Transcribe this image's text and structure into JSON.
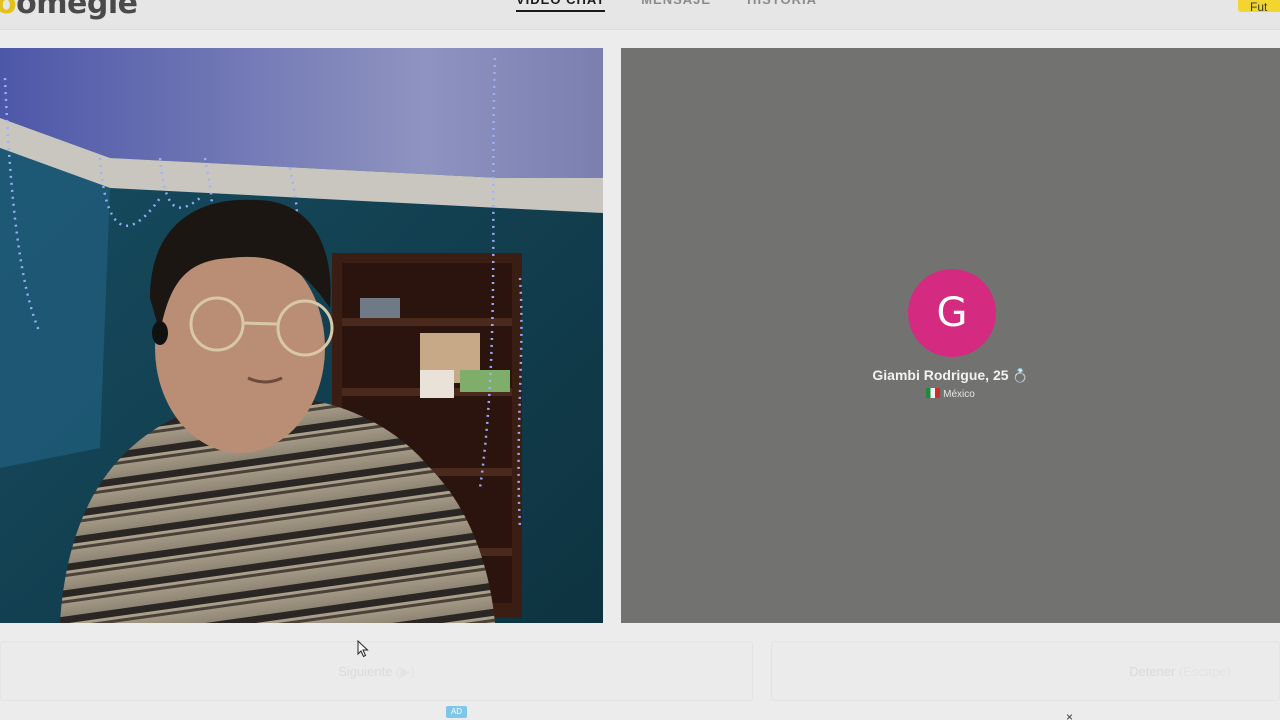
{
  "header": {
    "logo_text": "omegle",
    "nav": [
      "VIDEO CHAT",
      "MENSAJE",
      "HISTORIA"
    ],
    "active_nav": "VIDEO CHAT",
    "cta_label": "Fut"
  },
  "partner": {
    "avatar_letter": "G",
    "name_age": "Giambi Rodrigue, 25",
    "country": "México",
    "avatar_color": "#d42a7f"
  },
  "controls": {
    "next_label": "Siguiente",
    "next_hint": "(▶)",
    "stop_label": "Detener",
    "stop_hint": "(Escape)"
  },
  "ad": {
    "badge": "AD",
    "close": "×"
  },
  "colors": {
    "accent": "#f2d530",
    "remote_bg": "#727370"
  },
  "icons": {
    "ring": "ring-icon",
    "flag": "mexico-flag-icon",
    "cursor": "mouse-pointer-icon"
  }
}
